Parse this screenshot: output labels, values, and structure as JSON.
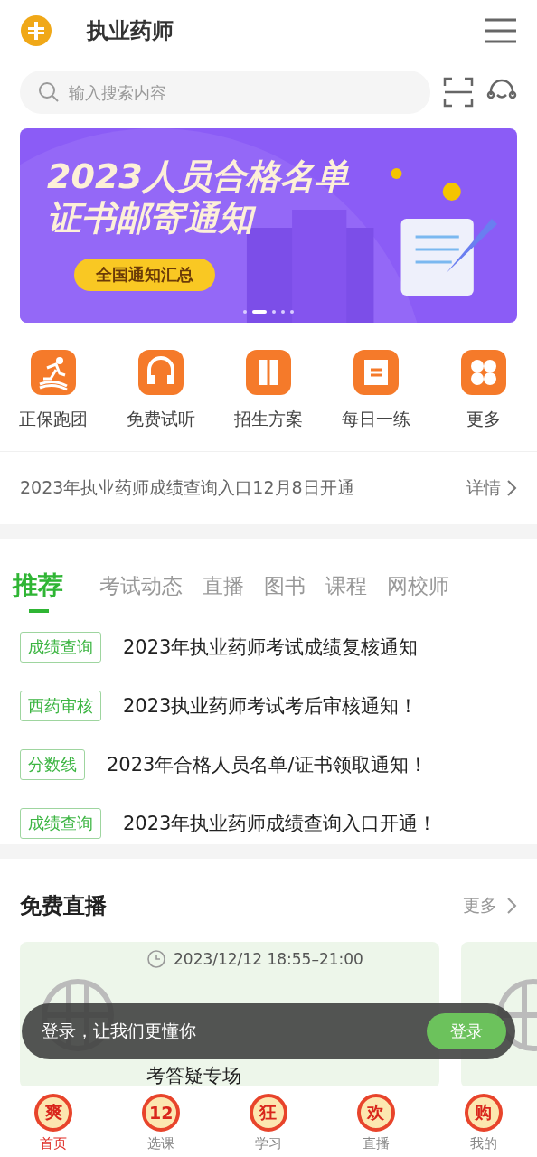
{
  "header": {
    "title": "执业药师"
  },
  "search": {
    "placeholder": "输入搜索内容"
  },
  "banner": {
    "title_lines": [
      "2023人员合格名单",
      "证书邮寄通知"
    ],
    "button": "全国通知汇总",
    "dots": [
      {
        "selected": false
      },
      {
        "selected": true
      },
      {
        "selected": false
      },
      {
        "selected": false
      },
      {
        "selected": false
      }
    ]
  },
  "shortcuts": [
    {
      "label": "正保跑团",
      "kind": "runner"
    },
    {
      "label": "免费试听",
      "kind": "headphones"
    },
    {
      "label": "招生方案",
      "kind": "book"
    },
    {
      "label": "每日一练",
      "kind": "note"
    },
    {
      "label": "更多",
      "kind": "grid"
    }
  ],
  "notice": {
    "text": "2023年执业药师成绩查询入口12月8日开通",
    "link": "详情"
  },
  "tabs": [
    {
      "label": "推荐",
      "selected": true
    },
    {
      "label": "考试动态",
      "selected": false
    },
    {
      "label": "直播",
      "selected": false
    },
    {
      "label": "图书",
      "selected": false
    },
    {
      "label": "课程",
      "selected": false
    },
    {
      "label": "网校师",
      "selected": false
    }
  ],
  "news": [
    {
      "tag": "成绩查询",
      "title": "2023年执业药师考试成绩复核通知"
    },
    {
      "tag": "西药审核",
      "title": "2023执业药师考试考后审核通知！"
    },
    {
      "tag": "分数线",
      "title": "2023年合格人员名单/证书领取通知！"
    },
    {
      "tag": "成绩查询",
      "title": "2023年执业药师成绩查询入口开通！"
    }
  ],
  "live": {
    "heading": "免费直播",
    "more": "更多",
    "cards": [
      {
        "time": "2023/12/12 18:55–21:00",
        "title": "考答疑专场"
      }
    ]
  },
  "toast": {
    "text": "登录，让我们更懂你",
    "button": "登录"
  },
  "nav": [
    {
      "badge": "爽",
      "label": "首页",
      "selected": true
    },
    {
      "badge": "12",
      "label": "选课",
      "selected": false
    },
    {
      "badge": "狂",
      "label": "学习",
      "selected": false
    },
    {
      "badge": "欢",
      "label": "直播",
      "selected": false
    },
    {
      "badge": "购",
      "label": "我的",
      "selected": false
    }
  ]
}
